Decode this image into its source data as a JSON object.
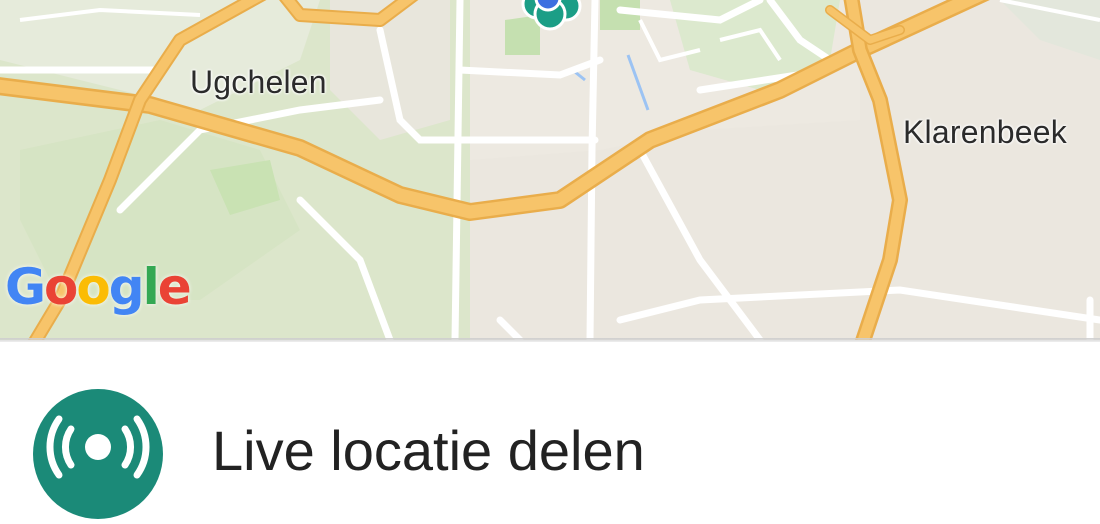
{
  "map": {
    "places": {
      "ugchelen": "Ugchelen",
      "klarenbeek": "Klarenbeek"
    },
    "attribution": {
      "letters": [
        "G",
        "o",
        "o",
        "g",
        "l",
        "e"
      ],
      "colors": [
        "#4285F4",
        "#EA4335",
        "#FBBC05",
        "#4285F4",
        "#34A853",
        "#EA4335"
      ]
    },
    "colors": {
      "land": "#ebe7df",
      "park": "#cfe3bd",
      "forest": "#dfe8cf",
      "highway": "#f7c46a",
      "highway_edge": "#e9ad4b",
      "street": "#ffffff",
      "water": "#9cc3f3",
      "marker": "#1b9e86"
    }
  },
  "sheet": {
    "title": "Live locatie delen",
    "icon": "live-location-icon",
    "icon_color": "#1b8a78"
  }
}
